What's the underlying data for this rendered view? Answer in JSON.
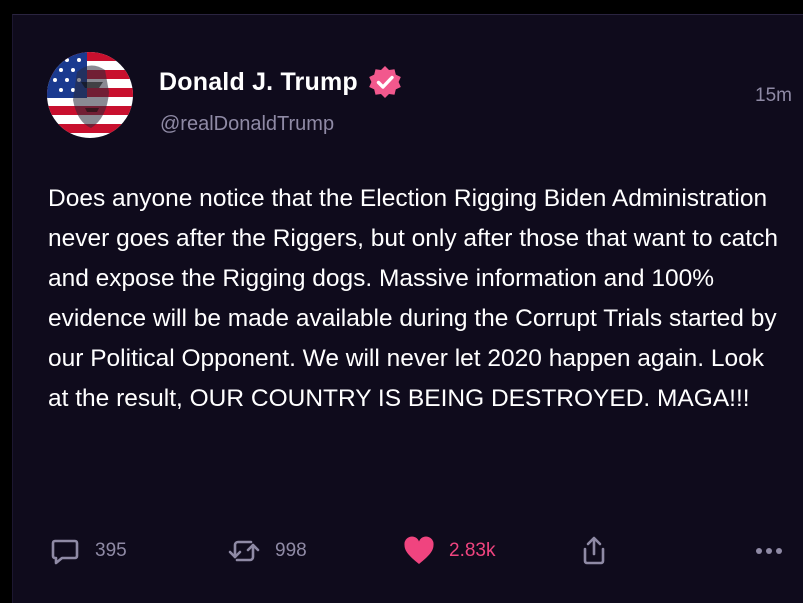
{
  "post": {
    "author": {
      "display_name": "Donald J. Trump",
      "handle": "@realDonaldTrump",
      "verified": true,
      "verified_color": "#f2588d"
    },
    "timestamp": "15m",
    "text": "Does anyone notice that the Election Rigging Biden Administration never goes after the Riggers, but only after those that want to catch and expose the Rigging dogs. Massive information and 100% evidence will be made available during the Corrupt Trials started by our Political Opponent. We will never let 2020 happen again. Look at the result, OUR COUNTRY IS BEING DESTROYED. MAGA!!!"
  },
  "actions": {
    "reply": {
      "icon": "speech-bubble-icon",
      "count": "395"
    },
    "repost": {
      "icon": "repost-arrows-icon",
      "count": "998"
    },
    "like": {
      "icon": "heart-icon",
      "count": "2.83k",
      "liked": true,
      "color": "#f0447f"
    },
    "share": {
      "icon": "share-upload-icon"
    },
    "more": {
      "icon": "more-dots-icon"
    }
  },
  "theme": {
    "background": "#0f0b1c",
    "text": "#ffffff",
    "muted": "#8f8aa5"
  }
}
